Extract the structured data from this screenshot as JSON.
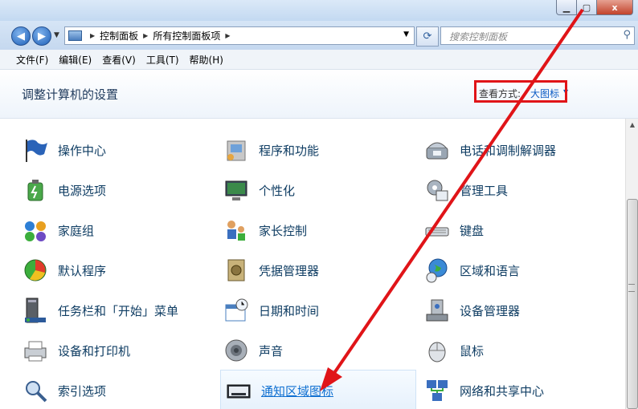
{
  "window": {
    "min_icon": "minimize-icon",
    "max_icon": "maximize-icon",
    "close_icon": "close-icon",
    "close_glyph": "x"
  },
  "nav": {
    "back": "back-arrow-icon",
    "forward": "forward-arrow-icon",
    "breadcrumbs": [
      "控制面板",
      "所有控制面板项"
    ],
    "search_placeholder": "搜索控制面板"
  },
  "menu": [
    "文件(F)",
    "编辑(E)",
    "查看(V)",
    "工具(T)",
    "帮助(H)"
  ],
  "header": {
    "title": "调整计算机的设置",
    "view_by_label": "查看方式:",
    "view_by_value": "大图标"
  },
  "items": [
    {
      "label": "操作中心",
      "icon": "action-center-flag-icon"
    },
    {
      "label": "程序和功能",
      "icon": "programs-features-icon"
    },
    {
      "label": "电话和调制解调器",
      "icon": "phone-modem-icon"
    },
    {
      "label": "电源选项",
      "icon": "power-options-icon"
    },
    {
      "label": "个性化",
      "icon": "personalization-icon"
    },
    {
      "label": "管理工具",
      "icon": "administrative-tools-icon"
    },
    {
      "label": "家庭组",
      "icon": "homegroup-icon"
    },
    {
      "label": "家长控制",
      "icon": "parental-controls-icon"
    },
    {
      "label": "键盘",
      "icon": "keyboard-icon"
    },
    {
      "label": "默认程序",
      "icon": "default-programs-icon"
    },
    {
      "label": "凭据管理器",
      "icon": "credential-manager-icon"
    },
    {
      "label": "区域和语言",
      "icon": "region-language-globe-icon"
    },
    {
      "label": "任务栏和「开始」菜单",
      "icon": "taskbar-start-menu-icon"
    },
    {
      "label": "日期和时间",
      "icon": "date-time-calendar-icon"
    },
    {
      "label": "设备管理器",
      "icon": "device-manager-icon"
    },
    {
      "label": "设备和打印机",
      "icon": "devices-printers-icon"
    },
    {
      "label": "声音",
      "icon": "sound-speaker-icon"
    },
    {
      "label": "鼠标",
      "icon": "mouse-icon"
    },
    {
      "label": "索引选项",
      "icon": "indexing-options-icon"
    },
    {
      "label": "通知区域图标",
      "icon": "notification-area-icons-icon"
    },
    {
      "label": "网络和共享中心",
      "icon": "network-sharing-center-icon"
    }
  ],
  "annotation_color": "#e01418"
}
